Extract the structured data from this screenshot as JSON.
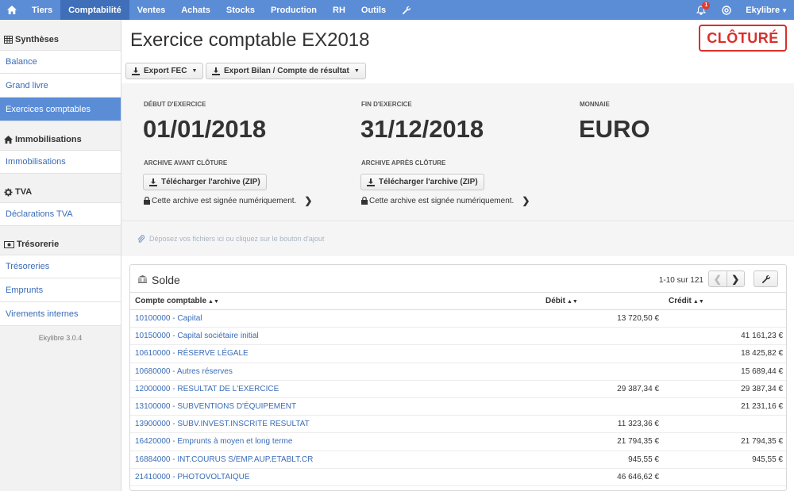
{
  "nav": {
    "items": [
      {
        "label": "Tiers",
        "active": false
      },
      {
        "label": "Comptabilité",
        "active": true
      },
      {
        "label": "Ventes",
        "active": false
      },
      {
        "label": "Achats",
        "active": false
      },
      {
        "label": "Stocks",
        "active": false
      },
      {
        "label": "Production",
        "active": false
      },
      {
        "label": "RH",
        "active": false
      },
      {
        "label": "Outils",
        "active": false
      }
    ],
    "notification_count": "1",
    "user": "Ekylibre"
  },
  "sidebar": {
    "sections": [
      {
        "title": "Synthèses",
        "icon": "table-icon",
        "links": [
          {
            "label": "Balance",
            "active": false
          },
          {
            "label": "Grand livre",
            "active": false
          },
          {
            "label": "Exercices comptables",
            "active": true
          }
        ]
      },
      {
        "title": "Immobilisations",
        "icon": "home-icon",
        "links": [
          {
            "label": "Immobilisations",
            "active": false
          }
        ]
      },
      {
        "title": "TVA",
        "icon": "gear-icon",
        "links": [
          {
            "label": "Déclarations TVA",
            "active": false
          }
        ]
      },
      {
        "title": "Trésorerie",
        "icon": "money-icon",
        "links": [
          {
            "label": "Trésoreries",
            "active": false
          },
          {
            "label": "Emprunts",
            "active": false
          },
          {
            "label": "Virements internes",
            "active": false
          }
        ]
      }
    ],
    "version": "Ekylibre 3.0.4"
  },
  "page": {
    "title": "Exercice comptable EX2018",
    "status_stamp": "CLÔTURÉ",
    "export_fec": "Export FEC",
    "export_bilan": "Export Bilan / Compte de résultat"
  },
  "info": {
    "start_label": "DÉBUT D'EXERCICE",
    "start_value": "01/01/2018",
    "end_label": "FIN D'EXERCICE",
    "end_value": "31/12/2018",
    "currency_label": "MONNAIE",
    "currency_value": "EURO",
    "archive_before_label": "ARCHIVE AVANT CLÔTURE",
    "archive_after_label": "ARCHIVE APRÈS CLÔTURE",
    "download_label": "Télécharger l'archive (ZIP)",
    "signed_text": "Cette archive est signée numériquement."
  },
  "dropzone": {
    "text": "Déposez vos fichiers ici ou cliquez sur le bouton d'ajout"
  },
  "solde": {
    "title": "Solde",
    "pager": "1-10 sur 121",
    "columns": [
      "Compte comptable",
      "Débit",
      "Crédit"
    ],
    "rows": [
      {
        "account": "10100000 - Capital",
        "debit": "13 720,50 €",
        "credit": ""
      },
      {
        "account": "10150000 - Capital sociétaire initial",
        "debit": "",
        "credit": "41 161,23 €"
      },
      {
        "account": "10610000 - RÉSERVE LÉGALE",
        "debit": "",
        "credit": "18 425,82 €"
      },
      {
        "account": "10680000 - Autres réserves",
        "debit": "",
        "credit": "15 689,44 €"
      },
      {
        "account": "12000000 - RESULTAT DE L'EXERCICE",
        "debit": "29 387,34 €",
        "credit": "29 387,34 €"
      },
      {
        "account": "13100000 - SUBVENTIONS D'ÉQUIPEMENT",
        "debit": "",
        "credit": "21 231,16 €"
      },
      {
        "account": "13900000 - SUBV.INVEST.INSCRITE RESULTAT",
        "debit": "11 323,36 €",
        "credit": ""
      },
      {
        "account": "16420000 - Emprunts à moyen et long terme",
        "debit": "21 794,35 €",
        "credit": "21 794,35 €"
      },
      {
        "account": "16884000 - INT.COURUS S/EMP.AUP.ETABLT.CR",
        "debit": "945,55 €",
        "credit": "945,55 €"
      },
      {
        "account": "21410000 - PHOTOVOLTAIQUE",
        "debit": "46 646,62 €",
        "credit": ""
      }
    ]
  }
}
